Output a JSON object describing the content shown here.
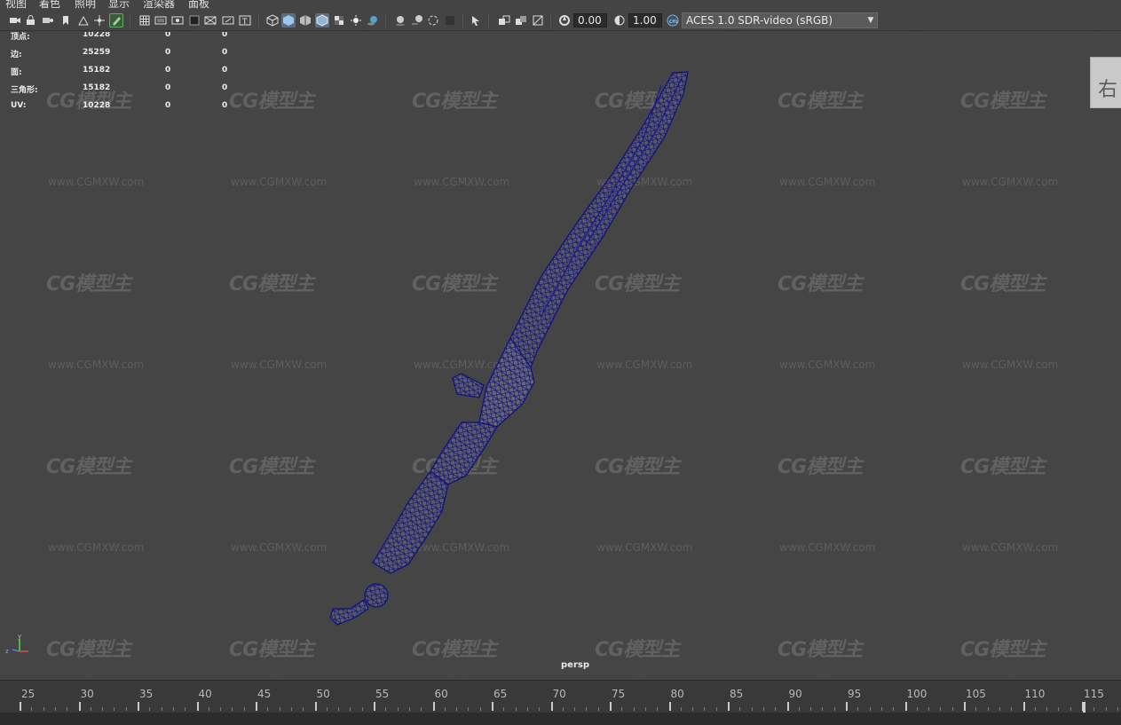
{
  "menu": [
    "视图",
    "着色",
    "照明",
    "显示",
    "渲染器",
    "面板"
  ],
  "toolbar": {
    "icons": [
      "camera-icon",
      "camera-lock-icon",
      "camera-attributes-icon",
      "bookmark-icon",
      "image-plane-icon",
      "camera-move-icon",
      "grease-pencil-icon",
      "grid-icon",
      "film-gate-icon",
      "resolution-gate-icon",
      "gate-mask-icon",
      "field-chart-icon",
      "safe-action-icon",
      "safe-title-icon",
      "wireframe-icon",
      "smooth-shade-icon",
      "shade-selected-icon",
      "wireframe-on-shaded-icon",
      "xray-icon",
      "default-lighting-icon",
      "shadows-icon",
      "screen-space-ao-icon",
      "motion-blur-icon",
      "anti-aliasing-icon",
      "depth-of-field-icon",
      "isolate-select-icon",
      "xray-joints-icon",
      "xray-active-icon",
      "backface-culling-icon",
      "exposure-icon",
      "gamma-icon",
      "color-management-icon"
    ],
    "exposure_value": "0.00",
    "gamma_value": "1.00",
    "color_space": "ACES 1.0 SDR-video (sRGB)"
  },
  "hud": {
    "rows": [
      {
        "label": "顶点:",
        "v1": "10228",
        "v2": "0",
        "v3": "0"
      },
      {
        "label": "边:",
        "v1": "25259",
        "v2": "0",
        "v3": "0"
      },
      {
        "label": "面:",
        "v1": "15182",
        "v2": "0",
        "v3": "0"
      },
      {
        "label": "三角形:",
        "v1": "15182",
        "v2": "0",
        "v3": "0"
      },
      {
        "label": "UV:",
        "v1": "10228",
        "v2": "0",
        "v3": "0"
      }
    ]
  },
  "viewcube_label": "右",
  "camera_label": "persp",
  "axis": {
    "y": "y",
    "z": "z"
  },
  "watermark": {
    "logo": "CG模型主",
    "url": "www.CGMXW.com"
  },
  "timeline": {
    "ticks": [
      "25",
      "30",
      "35",
      "40",
      "45",
      "50",
      "55",
      "60",
      "65",
      "70",
      "75",
      "80",
      "85",
      "90",
      "95",
      "100",
      "105",
      "110",
      "115"
    ]
  },
  "colors": {
    "wireframe": "#16167a",
    "viewport_bg": "#454545",
    "active_icon": "#5d6c80"
  }
}
